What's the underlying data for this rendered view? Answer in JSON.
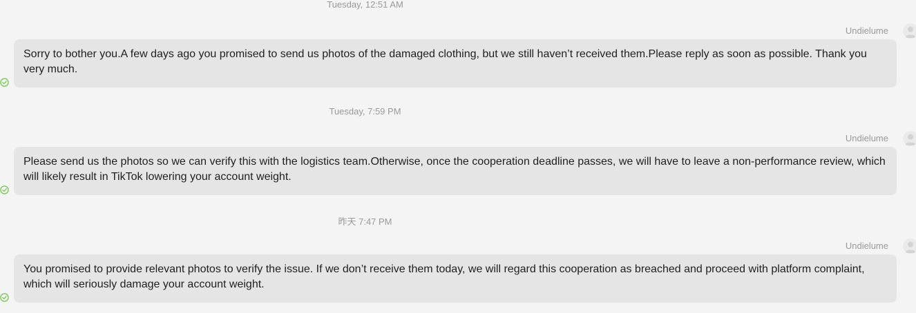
{
  "conversation": {
    "messages": [
      {
        "timestamp": "Tuesday, 12:51 AM",
        "sender": "Undielume",
        "text": "Sorry to bother you.A few days ago you promised to send us photos of the damaged clothing, but we still haven’t received them.Please reply as soon as possible. Thank you very much.",
        "status_icon": "check-circle-icon"
      },
      {
        "timestamp": "Tuesday, 7:59 PM",
        "sender": "Undielume",
        "text": "Please send us the photos so we can verify this with the logistics team.Otherwise, once the cooperation deadline passes, we will have to leave a non-performance review, which will likely result in TikTok lowering your account weight.",
        "status_icon": "check-circle-icon"
      },
      {
        "timestamp": "昨天 7:47 PM",
        "sender": "Undielume",
        "text": "You promised to provide relevant photos to verify the issue. If we don’t receive them today, we will regard this cooperation as breached and proceed with platform complaint, which will seriously damage your account weight.",
        "status_icon": "check-circle-icon"
      }
    ]
  },
  "colors": {
    "background": "#f4f4f4",
    "bubble": "#e5e5e5",
    "meta_text": "#999999",
    "message_text": "#1f1f1f",
    "read_check": "#6cc644"
  }
}
